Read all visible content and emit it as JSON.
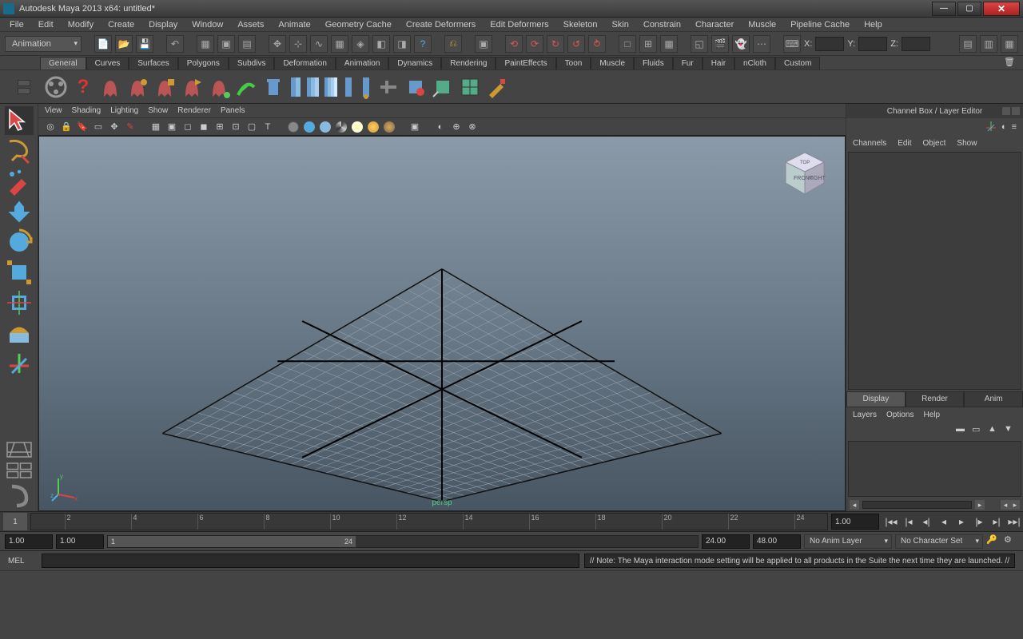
{
  "window": {
    "title": "Autodesk Maya 2013 x64: untitled*"
  },
  "menus": [
    "File",
    "Edit",
    "Modify",
    "Create",
    "Display",
    "Window",
    "Assets",
    "Animate",
    "Geometry Cache",
    "Create Deformers",
    "Edit Deformers",
    "Skeleton",
    "Skin",
    "Constrain",
    "Character",
    "Muscle",
    "Pipeline Cache",
    "Help"
  ],
  "moduleSelector": "Animation",
  "coords": {
    "x": "X:",
    "y": "Y:",
    "z": "Z:"
  },
  "shelfTabs": [
    "General",
    "Curves",
    "Surfaces",
    "Polygons",
    "Subdivs",
    "Deformation",
    "Animation",
    "Dynamics",
    "Rendering",
    "PaintEffects",
    "Toon",
    "Muscle",
    "Fluids",
    "Fur",
    "Hair",
    "nCloth",
    "Custom"
  ],
  "viewMenus": [
    "View",
    "Shading",
    "Lighting",
    "Show",
    "Renderer",
    "Panels"
  ],
  "viewLabel": "persp",
  "channelBox": {
    "title": "Channel Box / Layer Editor",
    "menus": [
      "Channels",
      "Edit",
      "Object",
      "Show"
    ]
  },
  "layerTabs": [
    "Display",
    "Render",
    "Anim"
  ],
  "layerMenus": [
    "Layers",
    "Options",
    "Help"
  ],
  "timeline": {
    "ticks": [
      "2",
      "4",
      "6",
      "8",
      "10",
      "12",
      "14",
      "16",
      "18",
      "20",
      "22",
      "24"
    ],
    "start": "1",
    "currentFrame": "1.00"
  },
  "range": {
    "startOuter": "1.00",
    "startInner": "1.00",
    "innerStart": "1",
    "innerEnd": "24",
    "endInner": "24.00",
    "endOuter": "48.00",
    "animLayer": "No Anim Layer",
    "charSet": "No Character Set"
  },
  "cmd": {
    "label": "MEL"
  },
  "helpNote": "// Note: The Maya interaction mode setting will be applied to all products in the Suite the next time they are launched. //"
}
